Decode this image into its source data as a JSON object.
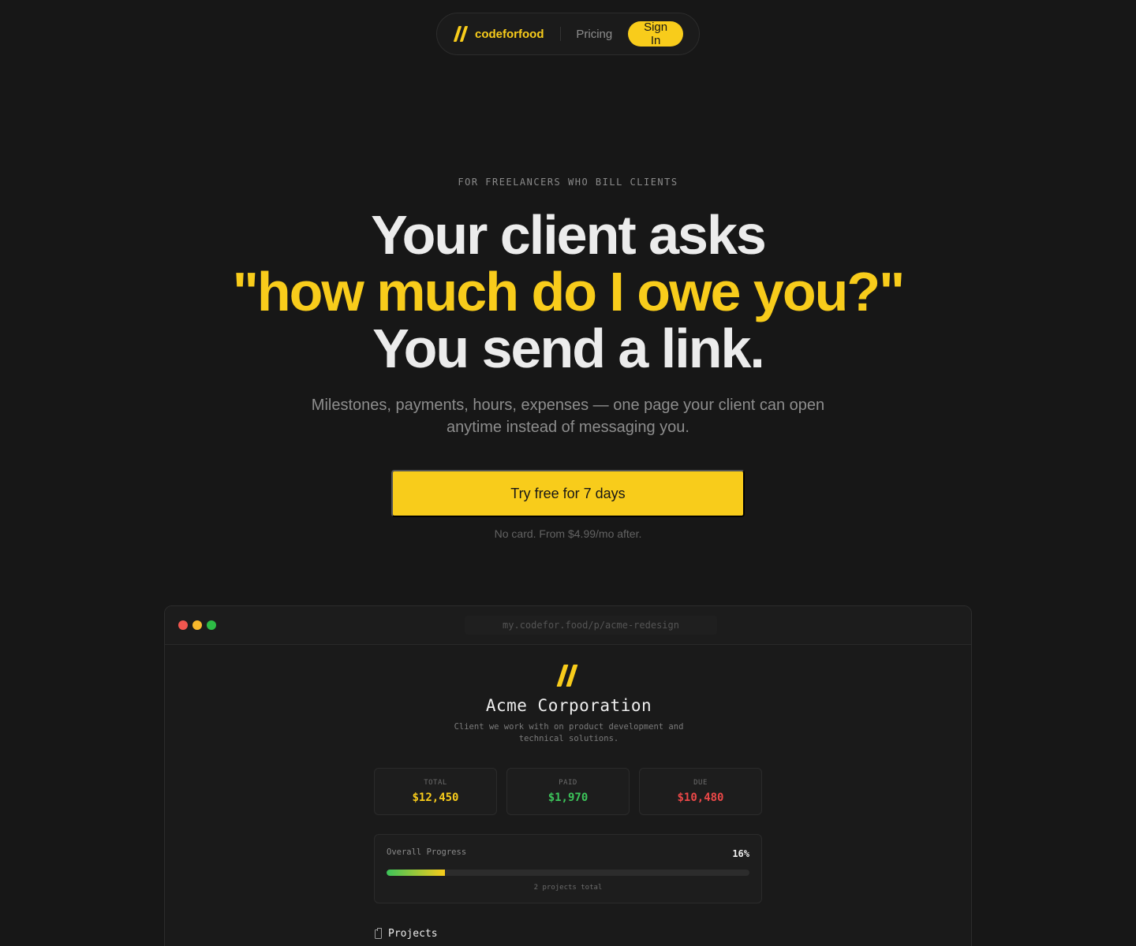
{
  "nav": {
    "brand": "codeforfood",
    "links": [
      "Pricing"
    ],
    "signin_label": "Sign In"
  },
  "hero": {
    "eyebrow": "FOR FREELANCERS WHO BILL CLIENTS",
    "headline_line1": "Your client asks",
    "headline_line2": "\"how much do I owe you?\"",
    "headline_line3": "You send a link.",
    "subhead": "Milestones, payments, hours, expenses — one page your client can open anytime instead of messaging you.",
    "cta_label": "Try free for 7 days",
    "cta_note": "No card. From $4.99/mo after."
  },
  "preview": {
    "url": "my.codefor.food/p/acme-redesign",
    "client_name": "Acme Corporation",
    "client_desc": "Client we work with on product development and technical solutions.",
    "stats": [
      {
        "label": "TOTAL",
        "value": "$12,450",
        "color": "#f8cc1b"
      },
      {
        "label": "PAID",
        "value": "$1,970",
        "color": "#3cc45a"
      },
      {
        "label": "DUE",
        "value": "$10,480",
        "color": "#ec4848"
      }
    ],
    "progress": {
      "label": "Overall Progress",
      "percent_label": "16%",
      "percent": 16,
      "note": "2 projects total"
    },
    "projects_heading": "Projects"
  },
  "colors": {
    "accent": "#f8cc1b",
    "background": "#171717"
  }
}
